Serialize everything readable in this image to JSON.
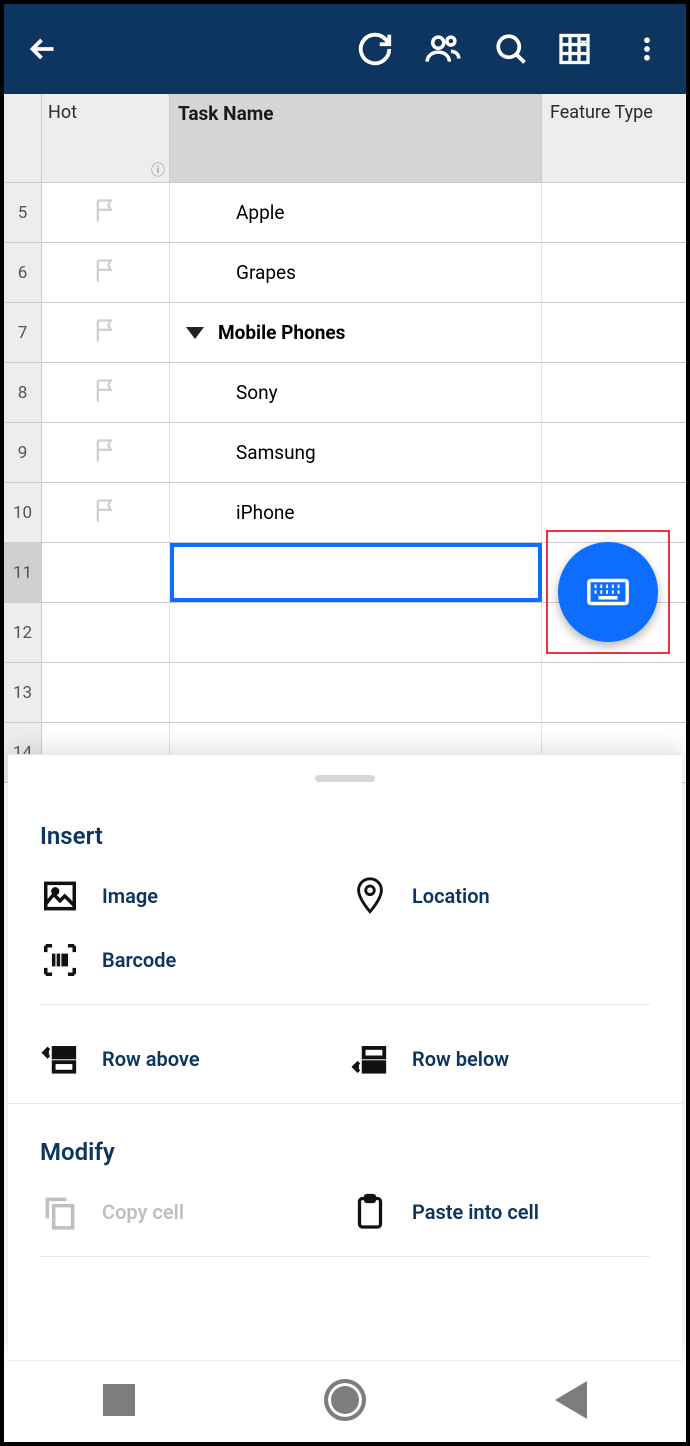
{
  "columns": {
    "hot": "Hot",
    "task": "Task Name",
    "feat": "Feature Type"
  },
  "rows": [
    {
      "num": "5",
      "flag": true,
      "indent": 1,
      "bold": false,
      "caret": false,
      "task": "Apple"
    },
    {
      "num": "6",
      "flag": true,
      "indent": 1,
      "bold": false,
      "caret": false,
      "task": "Grapes"
    },
    {
      "num": "7",
      "flag": true,
      "indent": 0,
      "bold": true,
      "caret": true,
      "task": "Mobile Phones"
    },
    {
      "num": "8",
      "flag": true,
      "indent": 1,
      "bold": false,
      "caret": false,
      "task": "Sony"
    },
    {
      "num": "9",
      "flag": true,
      "indent": 1,
      "bold": false,
      "caret": false,
      "task": "Samsung"
    },
    {
      "num": "10",
      "flag": true,
      "indent": 1,
      "bold": false,
      "caret": false,
      "task": "iPhone"
    },
    {
      "num": "11",
      "flag": false,
      "indent": 0,
      "bold": false,
      "caret": false,
      "task": "",
      "selected": true
    },
    {
      "num": "12",
      "flag": false,
      "indent": 0,
      "bold": false,
      "caret": false,
      "task": ""
    },
    {
      "num": "13",
      "flag": false,
      "indent": 0,
      "bold": false,
      "caret": false,
      "task": ""
    },
    {
      "num": "14",
      "flag": false,
      "indent": 0,
      "bold": false,
      "caret": false,
      "task": ""
    }
  ],
  "sheet": {
    "insert_title": "Insert",
    "image": "Image",
    "location": "Location",
    "barcode": "Barcode",
    "row_above": "Row above",
    "row_below": "Row below",
    "modify_title": "Modify",
    "copy_cell": "Copy cell",
    "paste_cell": "Paste into cell"
  }
}
